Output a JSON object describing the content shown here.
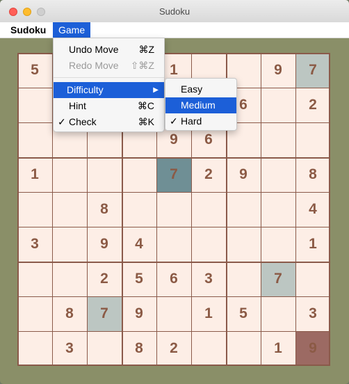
{
  "window": {
    "title": "Sudoku"
  },
  "menubar": {
    "app_menu": "Sudoku",
    "game_menu": "Game"
  },
  "game_menu": {
    "undo": {
      "label": "Undo Move",
      "shortcut": "⌘Z"
    },
    "redo": {
      "label": "Redo Move",
      "shortcut": "⇧⌘Z"
    },
    "difficulty": {
      "label": "Difficulty",
      "arrow": "▶"
    },
    "hint": {
      "label": "Hint",
      "shortcut": "⌘C"
    },
    "check": {
      "label": "Check",
      "shortcut": "⌘K",
      "checkmark": "✓"
    }
  },
  "difficulty_menu": {
    "easy": "Easy",
    "medium": "Medium",
    "hard": "Hard",
    "hard_check": "✓"
  },
  "board": {
    "rows": [
      [
        "5",
        "",
        "",
        "",
        "1",
        "",
        "",
        "9",
        "7"
      ],
      [
        "",
        "",
        "",
        "",
        "",
        "",
        "6",
        "",
        "2"
      ],
      [
        "",
        "",
        "",
        "",
        "9",
        "6",
        "",
        "",
        ""
      ],
      [
        "1",
        "",
        "",
        "",
        "7",
        "2",
        "9",
        "",
        "8"
      ],
      [
        "",
        "",
        "8",
        "",
        "",
        "",
        "",
        "",
        "4"
      ],
      [
        "3",
        "",
        "9",
        "4",
        "",
        "",
        "",
        "",
        "1"
      ],
      [
        "",
        "",
        "2",
        "5",
        "6",
        "3",
        "",
        "7",
        ""
      ],
      [
        "",
        "8",
        "7",
        "9",
        "",
        "1",
        "5",
        "",
        "3"
      ],
      [
        "",
        "3",
        "",
        "8",
        "2",
        "",
        "",
        "1",
        "9"
      ]
    ],
    "highlights": {
      "0-8": "a",
      "3-4": "b",
      "6-7": "a",
      "7-2": "a",
      "8-8": "c"
    }
  },
  "colors": {
    "board_bg": "#fdeee6",
    "digit": "#8b5a45",
    "grid_line": "#8a5a4a",
    "frame": "#8a8f68",
    "menu_selected": "#1c5fd8",
    "highlight_light": "#bcc6c2",
    "highlight_selected": "#6f8f95",
    "highlight_conflict": "#9c6a63"
  }
}
